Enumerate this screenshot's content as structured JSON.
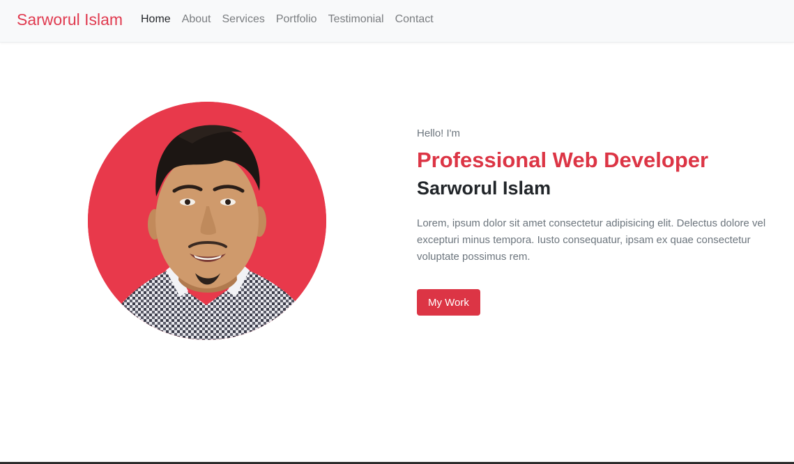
{
  "navbar": {
    "brand": "Sarworul Islam",
    "items": [
      {
        "label": "Home",
        "active": true
      },
      {
        "label": "About",
        "active": false
      },
      {
        "label": "Services",
        "active": false
      },
      {
        "label": "Portfolio",
        "active": false
      },
      {
        "label": "Testimonial",
        "active": false
      },
      {
        "label": "Contact",
        "active": false
      }
    ]
  },
  "hero": {
    "greeting": "Hello! I'm",
    "role": "Professional Web Developer",
    "name": "Sarworul Islam",
    "description": "Lorem, ipsum dolor sit amet consectetur adipisicing elit. Delectus dolore vel excepturi minus tempora. Iusto consequatur, ipsam ex quae consectetur voluptate possimus rem.",
    "button_label": "My Work",
    "photo_alt": "profile-photo"
  },
  "colors": {
    "accent": "#dc3545",
    "photo_background": "#e8394b",
    "navbar_background": "#f8f9fa",
    "heading": "#212529",
    "muted": "#6c757d"
  }
}
